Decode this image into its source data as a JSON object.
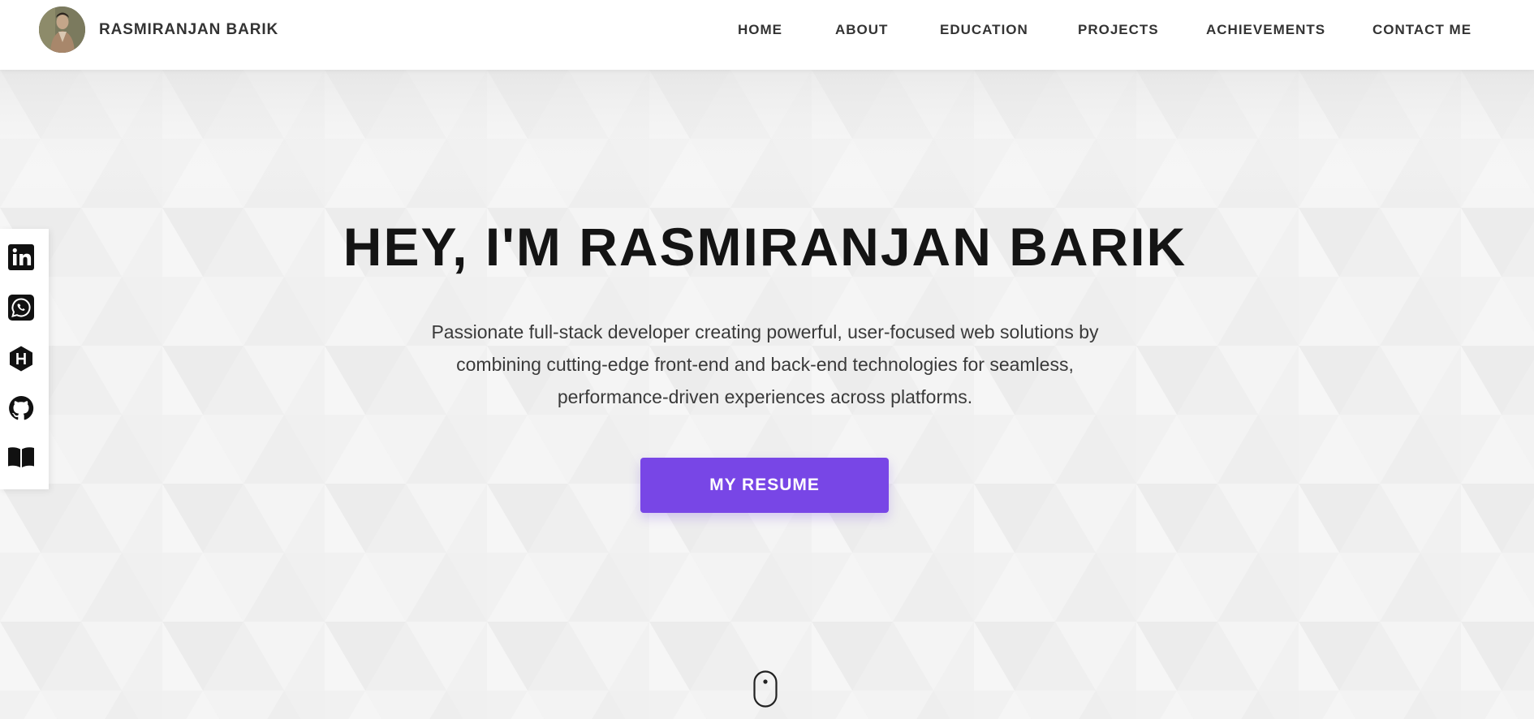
{
  "header": {
    "brand_name": "RASMIRANJAN BARIK",
    "nav": [
      {
        "label": "HOME"
      },
      {
        "label": "ABOUT"
      },
      {
        "label": "EDUCATION"
      },
      {
        "label": "PROJECTS"
      },
      {
        "label": "ACHIEVEMENTS"
      },
      {
        "label": "CONTACT ME"
      }
    ]
  },
  "hero": {
    "title": "HEY, I'M RASMIRANJAN BARIK",
    "description": "Passionate full-stack developer creating powerful, user-focused web solutions by combining cutting-edge front-end and back-end technologies for seamless, performance-driven experiences across platforms.",
    "button_label": "MY RESUME"
  },
  "social_links": [
    {
      "icon": "linkedin-icon"
    },
    {
      "icon": "whatsapp-icon"
    },
    {
      "icon": "hackerrank-icon"
    },
    {
      "icon": "github-icon"
    },
    {
      "icon": "book-icon"
    }
  ],
  "colors": {
    "accent": "#7846e6",
    "header_bg": "#ffffff",
    "hero_bg": "#f1f1f1",
    "title_text": "#141414"
  }
}
